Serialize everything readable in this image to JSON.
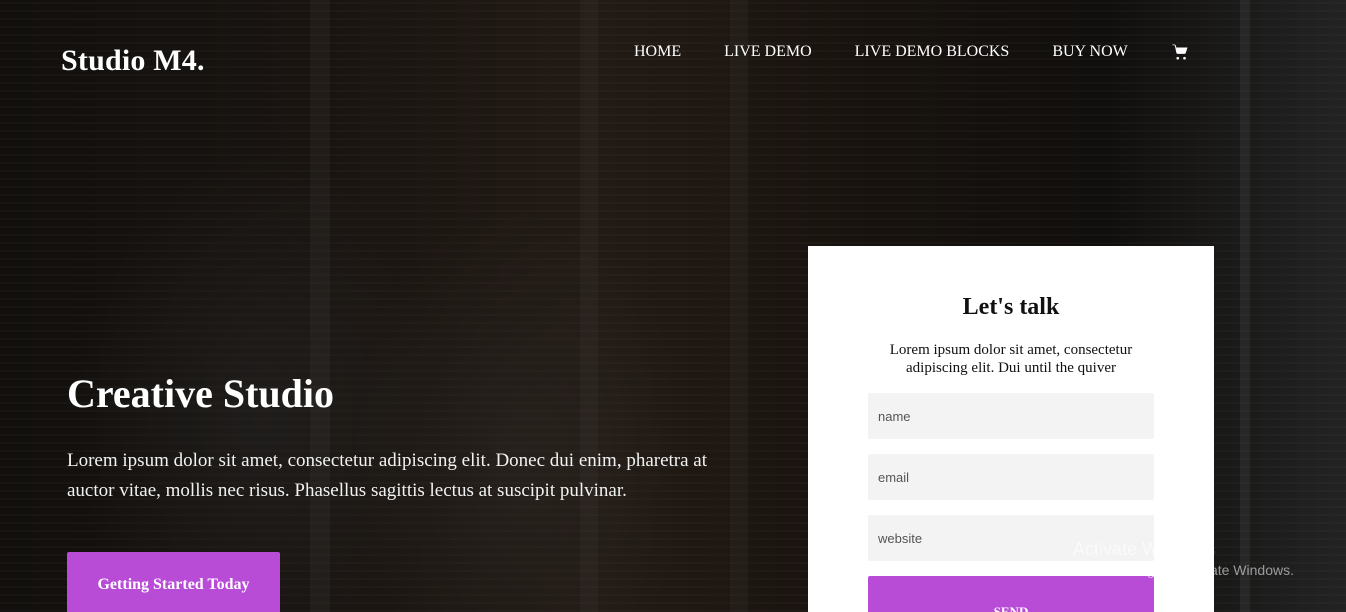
{
  "header": {
    "brand": "Studio M4.",
    "nav": [
      {
        "label": "HOME"
      },
      {
        "label": "LIVE DEMO"
      },
      {
        "label": "LIVE DEMO BLOCKS"
      },
      {
        "label": "BUY NOW"
      }
    ],
    "cart_icon": "shopping-cart-icon"
  },
  "hero": {
    "title": "Creative Studio",
    "description": "Lorem ipsum dolor sit amet, consectetur adipiscing elit. Donec dui enim, pharetra at auctor vitae, mollis nec risus. Phasellus sagittis lectus at suscipit pulvinar.",
    "cta_label": "Getting Started Today"
  },
  "contact_form": {
    "title": "Let's talk",
    "description": "Lorem ipsum dolor sit amet, consectetur adipiscing elit. Dui until the quiver",
    "name_placeholder": "name",
    "email_placeholder": "email",
    "website_placeholder": "website",
    "send_label": "SEND"
  },
  "windows_watermark": {
    "title": "Activate Windows",
    "subtitle": "Go to Settings to activate Windows."
  },
  "colors": {
    "accent": "#b84cd6",
    "form_bg": "#ffffff",
    "field_bg": "#f3f3f3"
  }
}
